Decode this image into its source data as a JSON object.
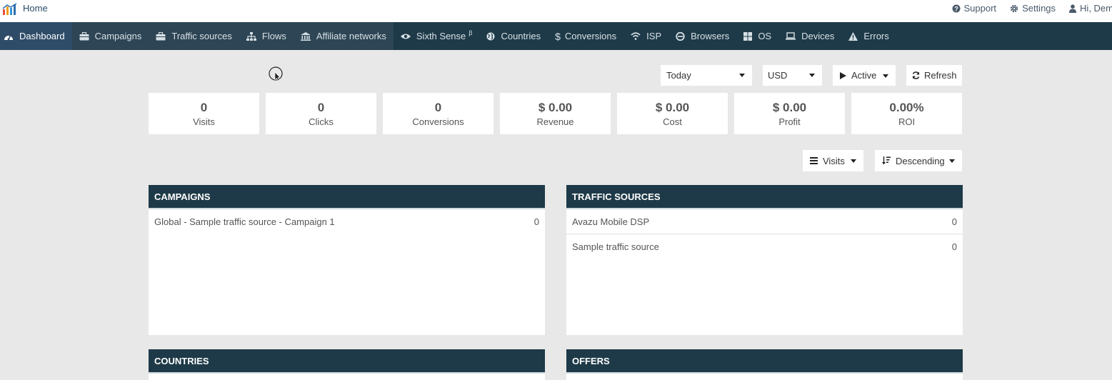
{
  "topbar": {
    "home_label": "Home",
    "support_label": "Support",
    "settings_label": "Settings",
    "user_label": "Hi, Dem"
  },
  "nav": {
    "items": [
      {
        "label": "Dashboard",
        "icon": "dashboard-icon"
      },
      {
        "label": "Campaigns",
        "icon": "briefcase-icon"
      },
      {
        "label": "Traffic sources",
        "icon": "briefcase-icon"
      },
      {
        "label": "Flows",
        "icon": "sitemap-icon"
      },
      {
        "label": "Affiliate networks",
        "icon": "bank-icon"
      },
      {
        "label": "Sixth Sense",
        "sup": "β",
        "icon": "eye-icon"
      },
      {
        "label": "Countries",
        "icon": "globe-icon"
      },
      {
        "label": "Conversions",
        "icon": "dollar-icon"
      },
      {
        "label": "ISP",
        "icon": "wifi-icon"
      },
      {
        "label": "Browsers",
        "icon": "browser-icon"
      },
      {
        "label": "OS",
        "icon": "windows-icon"
      },
      {
        "label": "Devices",
        "icon": "laptop-icon"
      },
      {
        "label": "Errors",
        "icon": "warning-icon"
      }
    ]
  },
  "controls": {
    "period": "Today",
    "currency": "USD",
    "status": "Active",
    "refresh": "Refresh",
    "sort_metric": "Visits",
    "sort_order": "Descending"
  },
  "stats": [
    {
      "value": "0",
      "label": "Visits"
    },
    {
      "value": "0",
      "label": "Clicks"
    },
    {
      "value": "0",
      "label": "Conversions"
    },
    {
      "value": "$ 0.00",
      "label": "Revenue"
    },
    {
      "value": "$ 0.00",
      "label": "Cost"
    },
    {
      "value": "$ 0.00",
      "label": "Profit"
    },
    {
      "value": "0.00%",
      "label": "ROI"
    }
  ],
  "panels": {
    "campaigns": {
      "title": "CAMPAIGNS",
      "rows": [
        {
          "name": "Global - Sample traffic source - Campaign 1",
          "value": "0"
        }
      ]
    },
    "traffic_sources": {
      "title": "TRAFFIC SOURCES",
      "rows": [
        {
          "name": "Avazu Mobile DSP",
          "value": "0"
        },
        {
          "name": "Sample traffic source",
          "value": "0"
        }
      ]
    },
    "countries": {
      "title": "COUNTRIES"
    },
    "offers": {
      "title": "OFFERS"
    }
  },
  "colors": {
    "navbar": "#1e3a48",
    "nav_active": "#2e4c68",
    "background": "#e8e8e8"
  }
}
